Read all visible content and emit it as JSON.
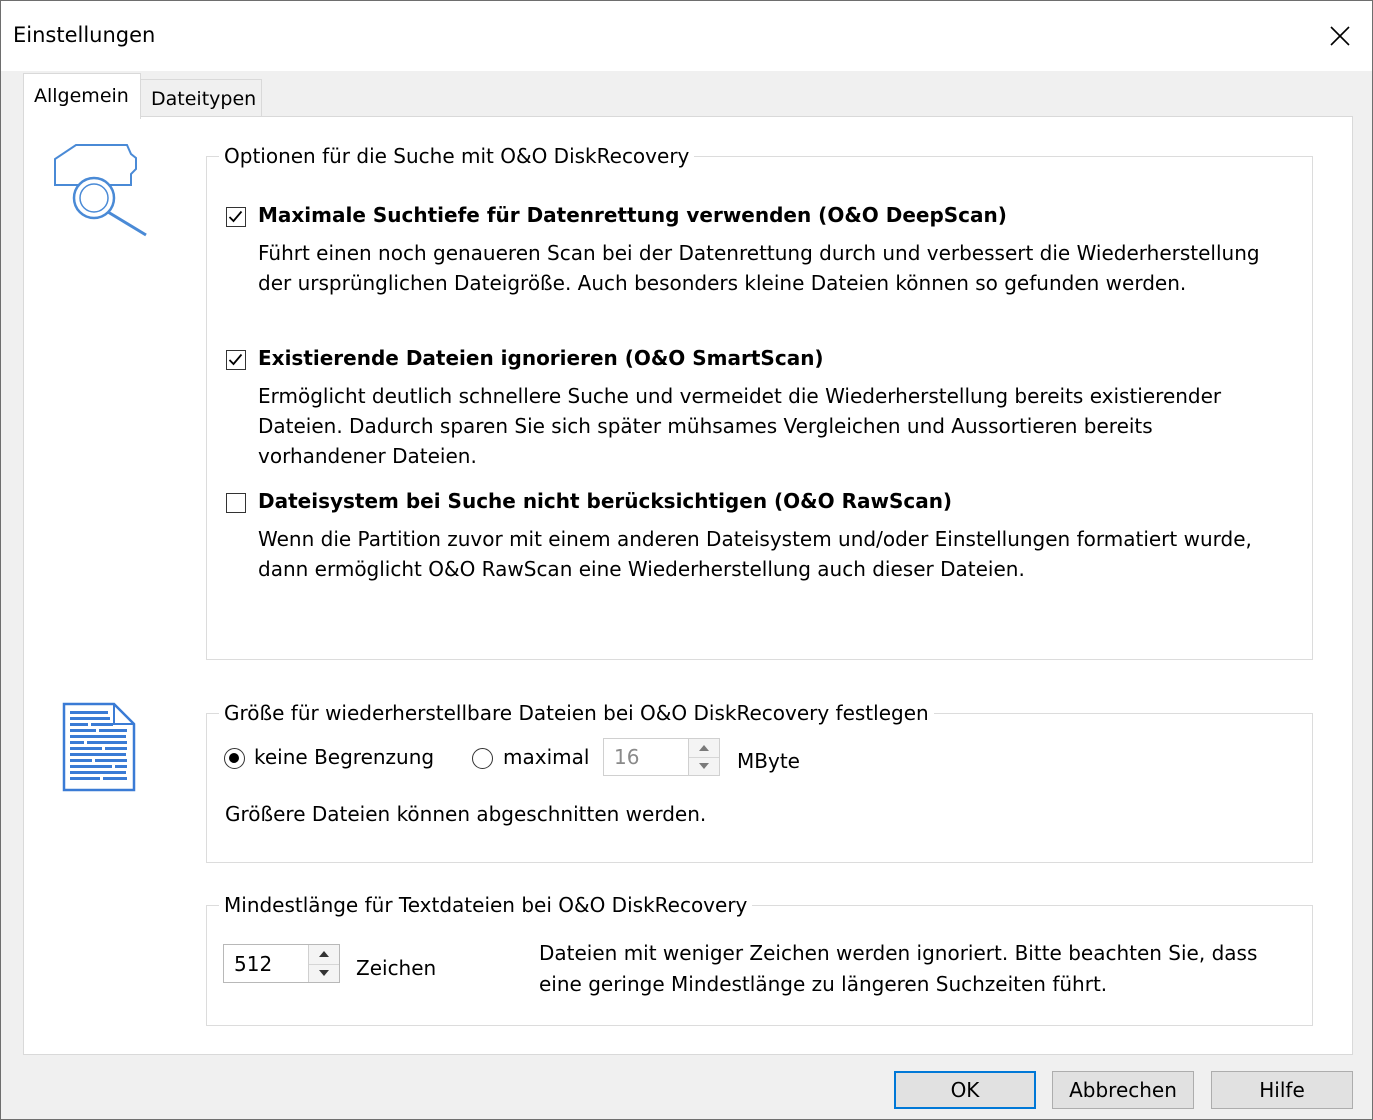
{
  "window": {
    "title": "Einstellungen"
  },
  "tabs": [
    {
      "label": "Allgemein",
      "active": true
    },
    {
      "label": "Dateitypen",
      "active": false
    }
  ],
  "search_options": {
    "legend": "Optionen für die Suche mit O&O DiskRecovery",
    "options": [
      {
        "label": "Maximale Suchtiefe für Datenrettung verwenden (O&O DeepScan)",
        "checked": true,
        "desc_lines": [
          "Führt einen noch genaueren Scan bei der Datenrettung durch und verbessert die Wiederherstellung",
          "der ursprünglichen Dateigröße. Auch besonders kleine Dateien können so gefunden werden."
        ]
      },
      {
        "label": "Existierende Dateien ignorieren (O&O SmartScan)",
        "checked": true,
        "desc_lines": [
          "Ermöglicht deutlich schnellere Suche und vermeidet die Wiederherstellung bereits existierender",
          "Dateien. Dadurch sparen Sie sich später mühsames Vergleichen und Aussortieren bereits",
          "vorhandener Dateien."
        ]
      },
      {
        "label": "Dateisystem bei Suche nicht berücksichtigen (O&O RawScan)",
        "checked": false,
        "desc_lines": [
          "Wenn die Partition zuvor mit einem anderen Dateisystem und/oder Einstellungen formatiert wurde,",
          "dann ermöglicht O&O RawScan eine Wiederherstellung auch dieser Dateien."
        ]
      }
    ]
  },
  "size_limit": {
    "legend": "Größe für wiederherstellbare Dateien bei O&O DiskRecovery festlegen",
    "no_limit_label": "keine Begrenzung",
    "no_limit_selected": true,
    "max_label": "maximal",
    "max_selected": false,
    "max_value": "16",
    "unit": "MByte",
    "note": "Größere Dateien können abgeschnitten werden."
  },
  "min_length": {
    "legend": "Mindestlänge für Textdateien bei O&O DiskRecovery",
    "value": "512",
    "unit": "Zeichen",
    "note_lines": [
      "Dateien mit weniger Zeichen werden ignoriert. Bitte beachten Sie, dass",
      "eine geringe Mindestlänge zu längeren Suchzeiten führt."
    ]
  },
  "buttons": {
    "ok": "OK",
    "cancel": "Abbrechen",
    "help": "Hilfe"
  },
  "colors": {
    "accent": "#0078d7",
    "icon_blue": "#3a7bd5"
  }
}
